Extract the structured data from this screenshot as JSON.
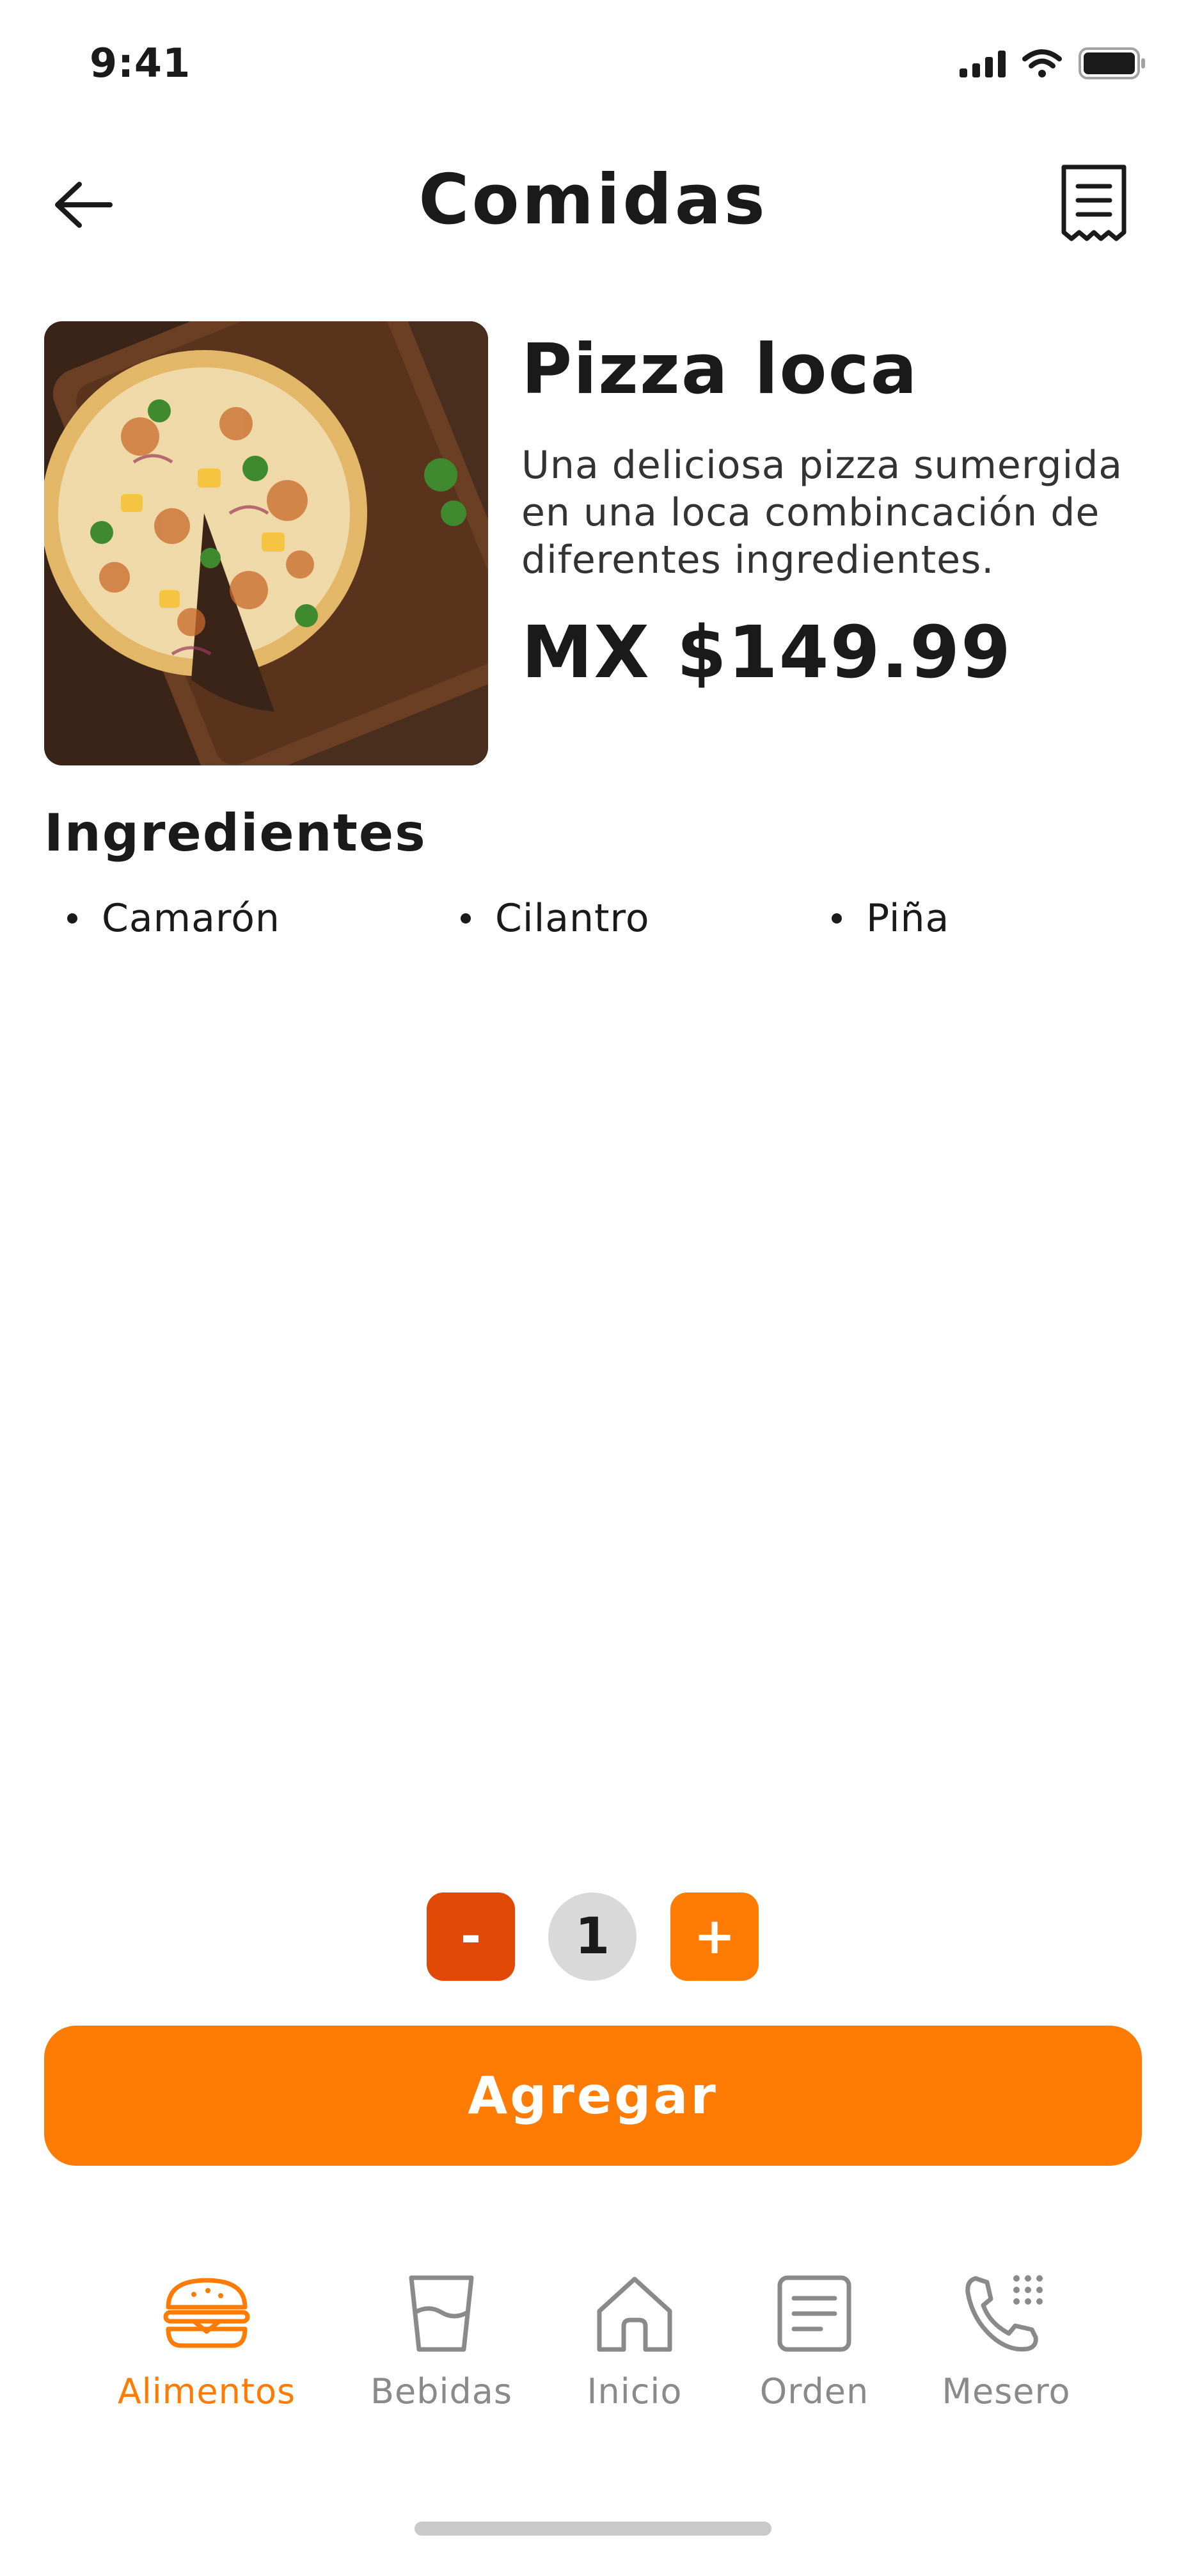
{
  "status_bar": {
    "time": "9:41"
  },
  "header": {
    "title": "Comidas"
  },
  "product": {
    "name": "Pizza loca",
    "description": "Una deliciosa pizza sumergida en una loca combincación de diferentes ingredientes.",
    "price": "MX $149.99"
  },
  "ingredients": {
    "title": "Ingredientes",
    "items": [
      "Camarón",
      "Cilantro",
      "Piña"
    ]
  },
  "quantity": {
    "minus_label": "-",
    "value": "1",
    "plus_label": "+"
  },
  "add_button": {
    "label": "Agregar"
  },
  "bottom_nav": {
    "items": [
      {
        "label": "Alimentos",
        "icon": "burger-icon",
        "active": true
      },
      {
        "label": "Bebidas",
        "icon": "cup-icon",
        "active": false
      },
      {
        "label": "Inicio",
        "icon": "home-icon",
        "active": false
      },
      {
        "label": "Orden",
        "icon": "order-icon",
        "active": false
      },
      {
        "label": "Mesero",
        "icon": "phone-icon",
        "active": false
      }
    ]
  },
  "colors": {
    "accent": "#fe7c04",
    "minus": "#e04906",
    "inactive": "#8a8a8a"
  }
}
